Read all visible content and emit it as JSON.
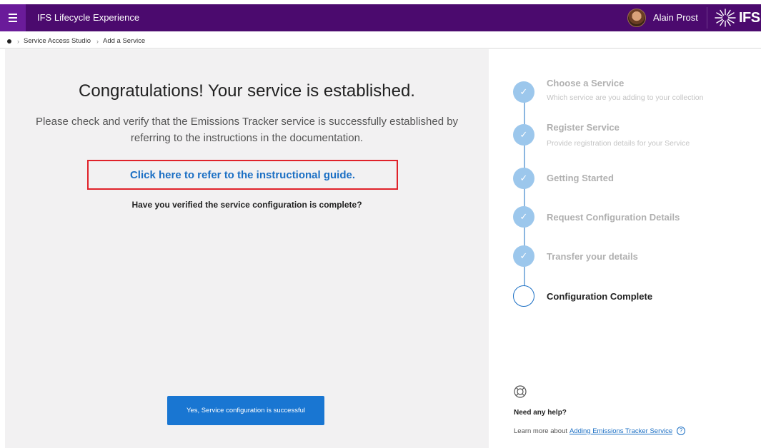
{
  "header": {
    "app_title": "IFS Lifecycle Experience",
    "username": "Alain Prost",
    "brand": "IFS"
  },
  "breadcrumb": {
    "items": [
      "Service Access Studio",
      "Add a Service"
    ]
  },
  "main": {
    "heading": "Congratulations! Your service is established.",
    "description": "Please check and verify that the Emissions Tracker service is successfully established by referring to the instructions in the documentation.",
    "guide_link": "Click here to refer to the instructional guide.",
    "verify_question": "Have you verified the service configuration is complete?",
    "confirm_button": "Yes, Service configuration is successful"
  },
  "steps": [
    {
      "title": "Choose a Service",
      "subtitle": "Which service are you adding to your collection",
      "status": "done"
    },
    {
      "title": "Register Service",
      "subtitle": "Provide registration details for your Service",
      "status": "done"
    },
    {
      "title": "Getting Started",
      "subtitle": "",
      "status": "done"
    },
    {
      "title": "Request Configuration Details",
      "subtitle": "",
      "status": "done"
    },
    {
      "title": "Transfer your details",
      "subtitle": "",
      "status": "done"
    },
    {
      "title": "Configuration Complete",
      "subtitle": "",
      "status": "current"
    }
  ],
  "help": {
    "title": "Need any help?",
    "prefix": "Learn more about",
    "link": "Adding Emissions Tracker Service"
  },
  "colors": {
    "header_bg": "#4b0a6e",
    "accent": "#1976d2",
    "step_done": "#9cc7ec",
    "highlight_border": "#e0222a"
  },
  "icons": {
    "menu": "hamburger-menu-icon",
    "check": "checkmark-icon",
    "help": "lifebuoy-icon",
    "info": "question-circle-icon",
    "home": "home-dot-icon"
  }
}
